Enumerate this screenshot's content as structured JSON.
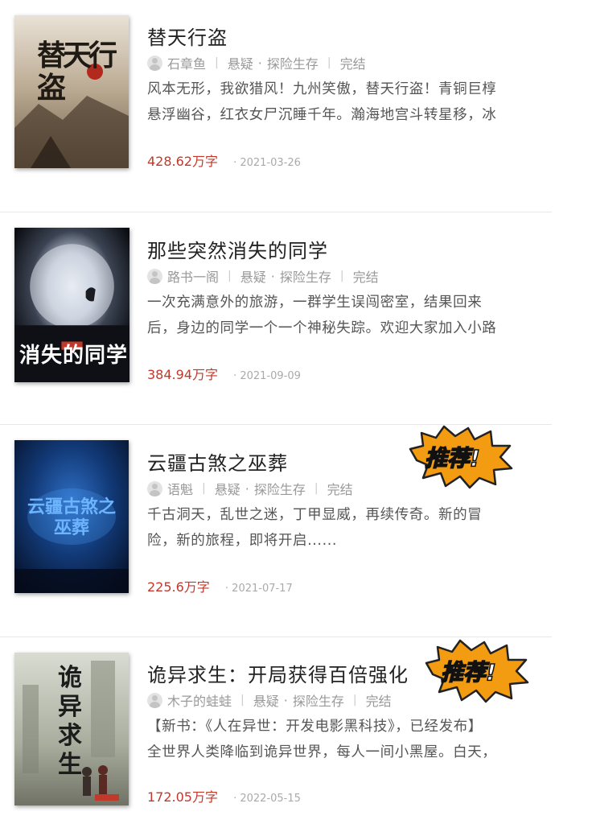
{
  "books": [
    {
      "title": "替天行盗",
      "author": "石章鱼",
      "genre": "悬疑",
      "subgenre": "探险生存",
      "status": "完结",
      "desc_line1": "风本无形，我欲猎风！九州笑傲，替天行盗！青铜巨椁",
      "desc_line2": "悬浮幽谷，红衣女尸沉睡千年。瀚海地宫斗转星移，冰",
      "words": "428.62万字",
      "date": "2021-03-26",
      "cover_text": "替天行盗",
      "recommended": false
    },
    {
      "title": "那些突然消失的同学",
      "author": "路书一阁",
      "genre": "悬疑",
      "subgenre": "探险生存",
      "status": "完结",
      "desc_line1": "一次充满意外的旅游，一群学生误闯密室，结果回来",
      "desc_line2": "后，身边的同学一个一个神秘失踪。欢迎大家加入小路",
      "words": "384.94万字",
      "date": "2021-09-09",
      "cover_text": "消失的同学",
      "recommended": false
    },
    {
      "title": "云疆古煞之巫葬",
      "author": "语魁",
      "genre": "悬疑",
      "subgenre": "探险生存",
      "status": "完结",
      "desc_line1": "千古洞天，乱世之迷，丁甲显威，再续传奇。新的冒",
      "desc_line2": "险，新的旅程，即将开启......",
      "words": "225.6万字",
      "date": "2021-07-17",
      "cover_text": "云疆古煞之巫葬",
      "recommended": true
    },
    {
      "title": "诡异求生：开局获得百倍强化",
      "author": "木子的蛙蛙",
      "genre": "悬疑",
      "subgenre": "探险生存",
      "status": "完结",
      "desc_line1": "【新书：《人在异世：开发电影黑科技》，已经发布】",
      "desc_line2": "全世界人类降临到诡异世界，每人一间小黑屋。白天，",
      "words": "172.05万字",
      "date": "2022-05-15",
      "cover_text": "诡异求生",
      "recommended": true
    }
  ],
  "badge_label": "推荐!",
  "colors": {
    "accent_red": "#c0392b",
    "badge_orange": "#f39c12",
    "meta_gray": "#999999"
  }
}
